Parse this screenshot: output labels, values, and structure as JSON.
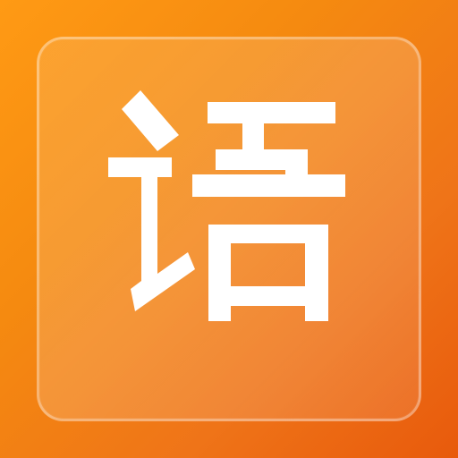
{
  "app_icon": {
    "glyph_text": "语",
    "colors": {
      "background_start": "#ff9a14",
      "background_end": "#e85a0c",
      "glyph": "#ffffff",
      "tile_border": "rgba(255,255,255,0.34)"
    }
  }
}
